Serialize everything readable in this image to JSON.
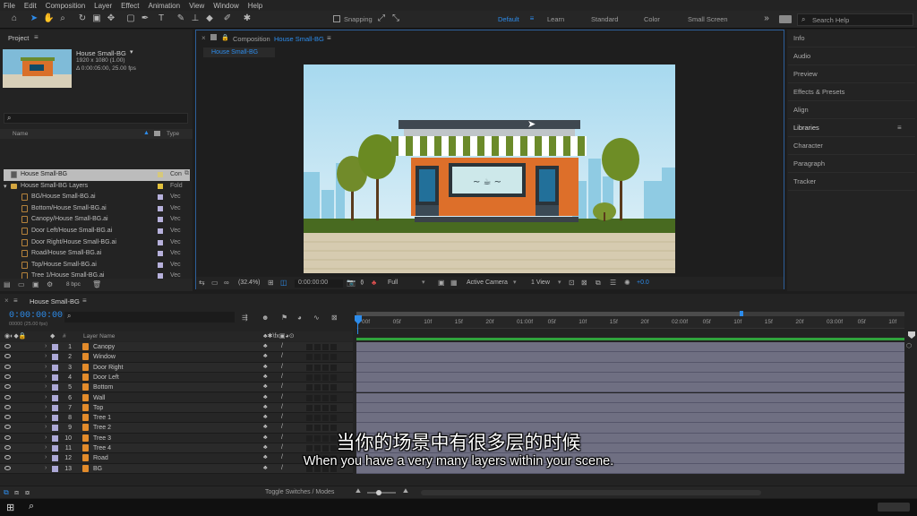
{
  "menu": [
    "File",
    "Edit",
    "Composition",
    "Layer",
    "Effect",
    "Animation",
    "View",
    "Window",
    "Help"
  ],
  "toolbar": {
    "snapping_label": "Snapping",
    "workspaces": [
      "Default",
      "Learn",
      "Standard",
      "Color",
      "Small Screen"
    ],
    "active_workspace": "Default",
    "search_placeholder": "Search Help"
  },
  "project": {
    "title": "Project",
    "comp_name": "House Small-BG",
    "comp_res": "1920 x 1080 (1.00)",
    "comp_duration": "Δ 0:00:05:00, 25.00 fps",
    "col_name": "Name",
    "col_type": "Type",
    "bpc": "8 bpc",
    "items": [
      {
        "name": "House Small-BG",
        "type": "Con",
        "kind": "comp",
        "color": "#d6c87a"
      },
      {
        "name": "House Small-BG Layers",
        "type": "Fold",
        "kind": "folder",
        "color": "#e2c13c"
      },
      {
        "name": "BG/House Small-BG.ai",
        "type": "Vec",
        "kind": "ai",
        "color": "#b7b1dc"
      },
      {
        "name": "Bottom/House Small-BG.ai",
        "type": "Vec",
        "kind": "ai",
        "color": "#b7b1dc"
      },
      {
        "name": "Canopy/House Small-BG.ai",
        "type": "Vec",
        "kind": "ai",
        "color": "#b7b1dc"
      },
      {
        "name": "Door Left/House Small-BG.ai",
        "type": "Vec",
        "kind": "ai",
        "color": "#b7b1dc"
      },
      {
        "name": "Door Right/House Small-BG.ai",
        "type": "Vec",
        "kind": "ai",
        "color": "#b7b1dc"
      },
      {
        "name": "Road/House Small-BG.ai",
        "type": "Vec",
        "kind": "ai",
        "color": "#b7b1dc"
      },
      {
        "name": "Top/House Small-BG.ai",
        "type": "Vec",
        "kind": "ai",
        "color": "#b7b1dc"
      },
      {
        "name": "Tree 1/House Small-BG.ai",
        "type": "Vec",
        "kind": "ai",
        "color": "#b7b1dc"
      },
      {
        "name": "Tree 2/House Small-BG.ai",
        "type": "Vec",
        "kind": "ai",
        "color": "#b7b1dc"
      },
      {
        "name": "Tree 3/House Small-BG.ai",
        "type": "Vec",
        "kind": "ai",
        "color": "#b7b1dc"
      }
    ]
  },
  "composition": {
    "panel_title_prefix": "Composition",
    "name": "House Small-BG",
    "tab": "House Small-BG",
    "zoom": "(32.4%)",
    "timecode": "0:00:00:00",
    "resolution": "Full",
    "camera": "Active Camera",
    "views": "1 View",
    "exposure": "+0.0"
  },
  "right_panel": [
    "Info",
    "Audio",
    "Preview",
    "Effects & Presets",
    "Align",
    "Libraries",
    "Character",
    "Paragraph",
    "Tracker"
  ],
  "timeline": {
    "tab": "House Small-BG",
    "timecode": "0:00:00:00",
    "fps_info": "00000 (25.00 fps)",
    "col_num": "#",
    "col_layer": "Layer Name",
    "toggle_label": "Toggle Switches / Modes",
    "ticks": [
      "00f",
      "05f",
      "10f",
      "15f",
      "20f",
      "01:00f",
      "05f",
      "10f",
      "15f",
      "20f",
      "02:00f",
      "05f",
      "10f",
      "15f",
      "20f",
      "03:00f",
      "05f",
      "10f"
    ],
    "layers": [
      {
        "num": "1",
        "name": "Canopy"
      },
      {
        "num": "2",
        "name": "Window"
      },
      {
        "num": "3",
        "name": "Door Right"
      },
      {
        "num": "4",
        "name": "Door Left"
      },
      {
        "num": "5",
        "name": "Bottom"
      },
      {
        "num": "6",
        "name": "Wall"
      },
      {
        "num": "7",
        "name": "Top"
      },
      {
        "num": "8",
        "name": "Tree 1"
      },
      {
        "num": "9",
        "name": "Tree 2"
      },
      {
        "num": "10",
        "name": "Tree 3"
      },
      {
        "num": "11",
        "name": "Tree 4"
      },
      {
        "num": "12",
        "name": "Road"
      },
      {
        "num": "13",
        "name": "BG"
      }
    ]
  },
  "subtitle": {
    "zh": "当你的场景中有很多层的时候",
    "en": "When you have a very many layers within your scene."
  },
  "colors": {
    "accent": "#2d8ceb",
    "layer_bar": "#6f6f82",
    "work_area": "#2fa33c",
    "label_lavender": "#aca8d6"
  }
}
